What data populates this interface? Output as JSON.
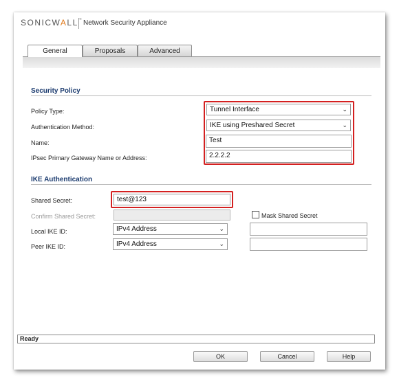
{
  "brand": {
    "logo_prefix": "SONICW",
    "logo_accent": "A",
    "logo_suffix": "LL",
    "trademark": "™",
    "product": "Network Security Appliance"
  },
  "tabs": [
    {
      "label": "General",
      "active": true
    },
    {
      "label": "Proposals",
      "active": false
    },
    {
      "label": "Advanced",
      "active": false
    }
  ],
  "security_policy": {
    "title": "Security Policy",
    "policy_type": {
      "label": "Policy Type:",
      "value": "Tunnel Interface"
    },
    "auth_method": {
      "label": "Authentication Method:",
      "value": "IKE using Preshared Secret"
    },
    "name": {
      "label": "Name:",
      "value": "Test"
    },
    "gateway": {
      "label": "IPsec Primary Gateway Name or Address:",
      "value": "2.2.2.2"
    }
  },
  "ike_auth": {
    "title": "IKE Authentication",
    "shared_secret": {
      "label": "Shared Secret:",
      "value": "test@123"
    },
    "confirm_secret": {
      "label": "Confirm Shared Secret:",
      "value": ""
    },
    "mask": {
      "label": "Mask Shared Secret",
      "checked": false
    },
    "local_ike_id": {
      "label": "Local IKE ID:",
      "type": "IPv4 Address",
      "value": ""
    },
    "peer_ike_id": {
      "label": "Peer IKE ID:",
      "type": "IPv4 Address",
      "value": ""
    }
  },
  "status": "Ready",
  "buttons": {
    "ok": "OK",
    "cancel": "Cancel",
    "help": "Help"
  },
  "colors": {
    "highlight": "#d42020",
    "section_title": "#1a3a6e",
    "brand_accent": "#e07818"
  },
  "icons": {
    "dropdown": "chevron-down-icon",
    "checkbox": "checkbox-icon"
  }
}
